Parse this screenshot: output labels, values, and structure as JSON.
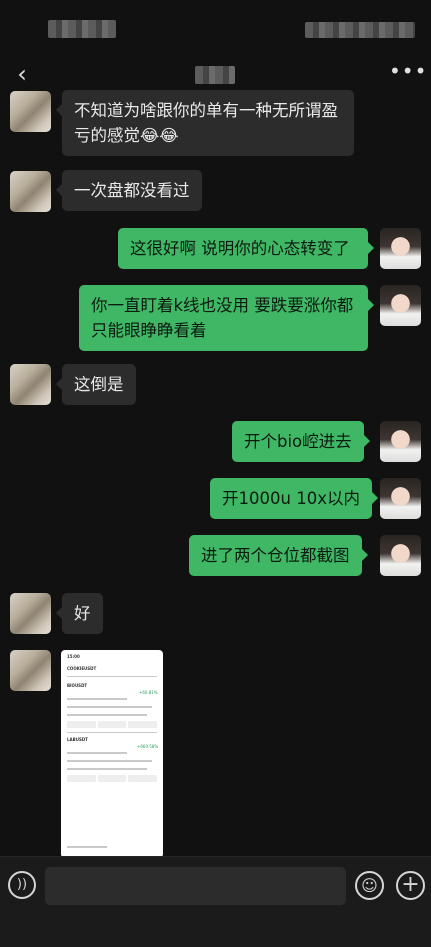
{
  "nav": {
    "back_icon": "‹",
    "more_icon": "•••"
  },
  "messages": [
    {
      "side": "left",
      "text": "不知道为啥跟你的单有一种无所谓盈亏的感觉😂😂"
    },
    {
      "side": "left",
      "text": "一次盘都没看过"
    },
    {
      "side": "right",
      "text": "这很好啊 说明你的心态转变了"
    },
    {
      "side": "right",
      "text": "你一直盯着k线也没用 要跌要涨你都只能眼睁睁看着"
    },
    {
      "side": "left",
      "text": "这倒是"
    },
    {
      "side": "right",
      "text": "开个bio崆进去"
    },
    {
      "side": "right",
      "text": "开1000u 10x以内"
    },
    {
      "side": "right",
      "text": "进了两个仓位都截图"
    },
    {
      "side": "left",
      "text": "好"
    }
  ],
  "screenshot": {
    "time": "15:00",
    "pair_title": "COOKIEUSDT",
    "position1": "BIOUSDT",
    "position1_pnl": "+60.81%",
    "position2": "LABUSDT",
    "position2_pnl": "+660.58%"
  },
  "input": {
    "placeholder": ""
  },
  "icons": {
    "voice": "voice-icon",
    "emoji": "emoji-icon",
    "plus": "plus-icon"
  },
  "colors": {
    "background": "#111111",
    "bubble_left": "#2c2c2c",
    "bubble_right": "#3fb765"
  }
}
